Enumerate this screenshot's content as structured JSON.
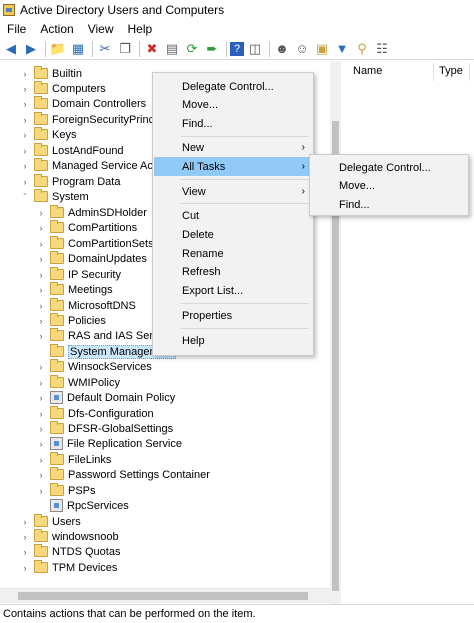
{
  "window": {
    "title": "Active Directory Users and Computers"
  },
  "menubar": {
    "items": [
      "File",
      "Action",
      "View",
      "Help"
    ]
  },
  "toolbar": {
    "icons": [
      "back-arrow-icon",
      "forward-arrow-icon",
      "up-folder-icon",
      "details-view-icon",
      "cut-icon",
      "copy-icon",
      "delete-icon",
      "properties-icon",
      "refresh-icon",
      "export-list-icon",
      "help-icon",
      "console-view-icon",
      "add-user-icon",
      "add-group-icon",
      "add-ou-icon",
      "filter-icon",
      "find-icon",
      "add-to-group-icon"
    ]
  },
  "tree": {
    "nodes": [
      "Builtin",
      "Computers",
      "Domain Controllers",
      "ForeignSecurityPrincip",
      "Keys",
      "LostAndFound",
      "Managed Service Acco",
      "Program Data",
      "System",
      "AdminSDHolder",
      "ComPartitions",
      "ComPartitionSets",
      "DomainUpdates",
      "IP Security",
      "Meetings",
      "MicrosoftDNS",
      "Policies",
      "RAS and IAS Server",
      "System Management",
      "WinsockServices",
      "WMIPolicy",
      "Default Domain Policy",
      "Dfs-Configuration",
      "DFSR-GlobalSettings",
      "File Replication Service",
      "FileLinks",
      "Password Settings Container",
      "PSPs",
      "RpcServices",
      "Users",
      "windowsnoob",
      "NTDS Quotas",
      "TPM Devices"
    ]
  },
  "details": {
    "columns": [
      "Name",
      "Type"
    ]
  },
  "context_menu": {
    "items": [
      "Delegate Control...",
      "Move...",
      "Find...",
      "New",
      "All Tasks",
      "View",
      "Cut",
      "Delete",
      "Rename",
      "Refresh",
      "Export List...",
      "Properties",
      "Help"
    ]
  },
  "submenu": {
    "items": [
      "Delegate Control...",
      "Move...",
      "Find..."
    ]
  },
  "status": {
    "text": "Contains actions that can be performed on the item."
  },
  "colors": {
    "selection": "#cce8ff",
    "menu_highlight": "#91c9f7",
    "menu_bg": "#f2f2f2"
  }
}
